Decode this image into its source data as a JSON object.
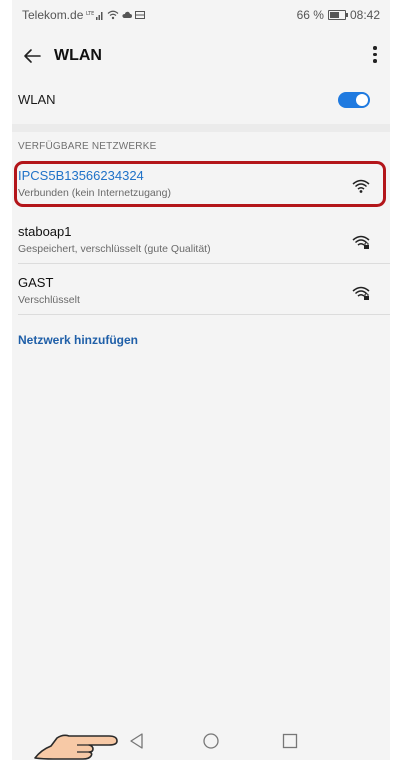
{
  "status_bar": {
    "carrier": "Telekom.de",
    "battery_percent": "66 %",
    "time": "08:42"
  },
  "app_bar": {
    "title": "WLAN"
  },
  "wlan_toggle": {
    "label": "WLAN",
    "enabled": true
  },
  "networks_section": {
    "header": "VERFÜGBARE NETZWERKE",
    "networks": [
      {
        "name": "IPCS5B13566234324",
        "status": "Verbunden (kein Internetzugang)",
        "connected": true,
        "highlighted": true
      },
      {
        "name": "staboap1",
        "status": "Gespeichert, verschlüsselt (gute Qualität)",
        "connected": false,
        "highlighted": false
      },
      {
        "name": "GAST",
        "status": "Verschlüsselt",
        "connected": false,
        "highlighted": false
      }
    ],
    "add_network_label": "Netzwerk hinzufügen"
  },
  "navigation_bar": {
    "icons": [
      "back-triangle-icon",
      "home-circle-icon",
      "recent-square-icon"
    ]
  },
  "icons": {
    "back": "arrow-left-icon",
    "overflow": "vertical-dots-icon",
    "wifi": "wifi-signal-icon",
    "pointer": "pointing-hand-icon"
  },
  "colors": {
    "accent": "#1f7ae0",
    "highlight_border": "#b3151a",
    "connected_text": "#1f72c8",
    "link": "#1f5fa8"
  }
}
